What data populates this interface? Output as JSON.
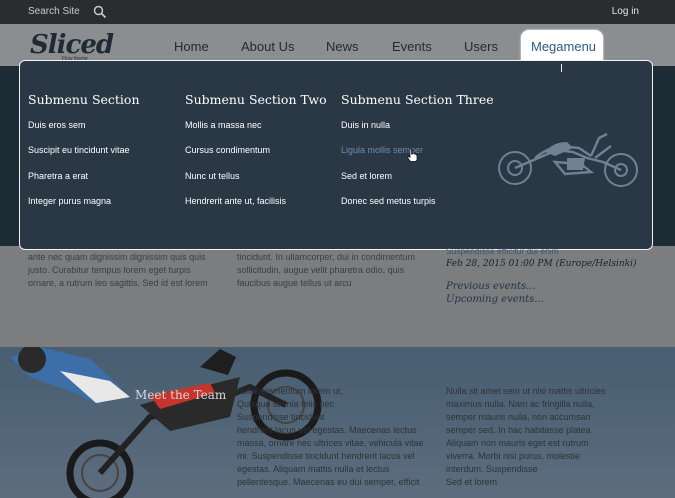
{
  "topbar": {
    "search_label": "Search Site",
    "login_label": "Log in"
  },
  "logo": {
    "text": "Sliced",
    "tagline": "Flow theme"
  },
  "nav": {
    "items": [
      "Home",
      "About Us",
      "News",
      "Events",
      "Users"
    ],
    "active": "Megamenu"
  },
  "megamenu": {
    "sections": [
      {
        "title": "Submenu Section",
        "links": [
          "Duis eros sem",
          "Suscipit eu tincidunt vitae",
          "Pharetra a erat",
          "Integer purus magna"
        ]
      },
      {
        "title": "Submenu Section Two",
        "links": [
          "Mollis a massa nec",
          "Cursus condimentum",
          "Nunc ut tellus",
          "Hendrerit ante ut, facilisis"
        ]
      },
      {
        "title": "Submenu Section Three",
        "links": [
          "Duis in nulla",
          "Ligula mollis semper",
          "Sed et lorem",
          "Donec sed metus turpis"
        ]
      }
    ],
    "hovered_link": "Ligula mollis semper"
  },
  "content": {
    "col1": [
      "ante nec quam dignissim dignissim quis quis",
      "justo. Curabitur tempus lorem eget turpis",
      "ornare, a rutrum leo sagittis. Sed id est lorem"
    ],
    "col2": [
      "tincidunt. In ullamcorper, dui in condimentum",
      "sollicitudin, augue velit pharetra odio, quis",
      "faucibus augue tellus ut arcu"
    ],
    "side_link": "Suspendisse efficitur dui enim",
    "side_date": "Feb 28, 2015 01:00 PM (Europe/Helsinki)",
    "previous": "Previous events...",
    "upcoming": "Upcoming events..."
  },
  "hero": {
    "title": "Meet the Team",
    "col1": [
      "nulla, elementum lorem ut,",
      "Quisque lacinia felis nec",
      "Suspendisse tincidunt",
      "hendrerit lacus vel egestas. Maecenas lectus",
      "massa, ornare nec ultrices vitae, vehicula vitae",
      "mi. Suspendisse tincidunt hendrerit lacus vel",
      "egestas. Aliquam mattis nulla et lectus",
      "pellentesque. Maecenas eu dui semper, efficit"
    ],
    "col2": [
      "Nulla sit amet sem ut nisi mattis ultricies",
      "maximus nulla. Nam ac fringilla nulla,",
      "semper mauris nulla, non accumsan",
      "semper sed. In hac habitasse platea",
      "Aliquam non mauris eget est rutrum",
      "viverra. Morbi nisi purus, molestie",
      "interdum. Suspendisse",
      "Sed et lorem"
    ]
  }
}
